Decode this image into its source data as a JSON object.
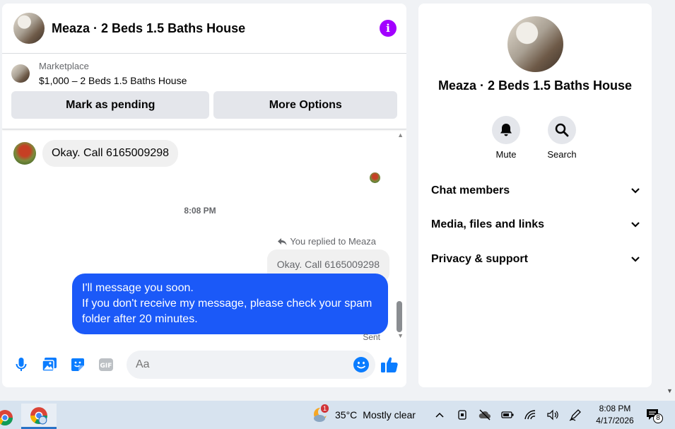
{
  "chat": {
    "title": "Meaza · 2 Beds 1.5 Baths House",
    "listing": {
      "source": "Marketplace",
      "price_title": "$1,000 – 2 Beds 1.5 Baths House",
      "mark_pending": "Mark as pending",
      "more_options": "More Options"
    },
    "messages": {
      "incoming_text": "Okay. Call 6165009298",
      "timestamp": "8:08 PM",
      "replied_to": "You replied to Meaza",
      "quoted_text": "Okay. Call 6165009298",
      "outgoing_line1": "I'll message you soon.",
      "outgoing_line2": "If you don't receive my message, please check your spam folder after 20 minutes.",
      "status": "Sent"
    },
    "composer": {
      "placeholder": "Aa"
    }
  },
  "info": {
    "title": "Meaza · 2 Beds 1.5 Baths House",
    "actions": {
      "mute": "Mute",
      "search": "Search"
    },
    "sections": [
      "Chat members",
      "Media, files and links",
      "Privacy & support"
    ]
  },
  "taskbar": {
    "weather_temp": "35°C",
    "weather_desc": "Mostly clear",
    "weather_badge": "1",
    "time": "8:08 PM",
    "date": "4/17/2026",
    "notif_count": "8"
  },
  "colors": {
    "accent_blue": "#1b59f8",
    "info_purple": "#a200ff",
    "icon_blue": "#0a7cff"
  }
}
